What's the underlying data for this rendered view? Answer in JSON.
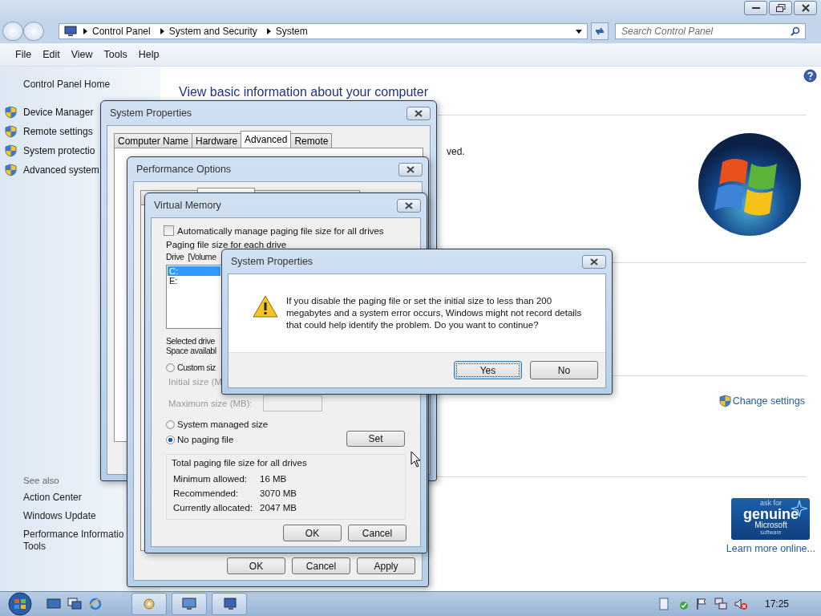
{
  "explorer": {
    "breadcrumbs": [
      "Control Panel",
      "System and Security",
      "System"
    ],
    "search_placeholder": "Search Control Panel",
    "menu": [
      "File",
      "Edit",
      "View",
      "Tools",
      "Help"
    ]
  },
  "sidebar": {
    "home": "Control Panel Home",
    "tasks": [
      "Device Manager",
      "Remote settings",
      "System protectio",
      "Advanced system"
    ],
    "see_also_title": "See also",
    "see_also": [
      {
        "lines": [
          "Action Center"
        ]
      },
      {
        "lines": [
          "Windows Update"
        ]
      },
      {
        "lines": [
          "Performance Informatio",
          "Tools"
        ]
      }
    ]
  },
  "main": {
    "heading": "View basic information about your computer",
    "fragment": "ved.",
    "change_settings": "Change settings",
    "genuine": [
      "ask for",
      "genuine",
      "Microsoft",
      "software"
    ],
    "learn_more": "Learn more online..."
  },
  "system_properties": {
    "title": "System Properties",
    "tabs": [
      {
        "label": "Computer Name",
        "selected": false
      },
      {
        "label": "Hardware",
        "selected": false
      },
      {
        "label": "Advanced",
        "selected": true
      },
      {
        "label": "Remote",
        "selected": false
      }
    ]
  },
  "performance_options": {
    "title": "Performance Options",
    "tabs": [
      {
        "selected": false
      },
      {
        "selected": true
      },
      {
        "selected": false
      }
    ],
    "buttons": [
      "OK",
      "Cancel",
      "Apply"
    ]
  },
  "virtual_memory": {
    "title": "Virtual Memory",
    "auto_manage": {
      "label": "Automatically manage paging file size for all drives",
      "checked": false
    },
    "paging_label": "Paging file size for each drive",
    "columns": [
      "Drive",
      "[Volume"
    ],
    "drives": [
      {
        "label": "C:",
        "selected": true
      },
      {
        "label": "E:",
        "selected": false
      }
    ],
    "selected_drive_label": "Selected drive",
    "space_label": "Space availabl",
    "custom": {
      "label": "Custom siz",
      "selected": false
    },
    "initial_label": "Initial size (M",
    "maximum_label": "Maximum size (MB):",
    "options": [
      {
        "label": "System managed size",
        "selected": false
      },
      {
        "label": "No paging file",
        "selected": true
      }
    ],
    "set_button": "Set",
    "totals": {
      "title": "Total paging file size for all drives",
      "rows": [
        {
          "label": "Minimum allowed:",
          "value": "16 MB"
        },
        {
          "label": "Recommended:",
          "value": "3070 MB"
        },
        {
          "label": "Currently allocated:",
          "value": "2047 MB"
        }
      ]
    },
    "buttons": [
      "OK",
      "Cancel"
    ]
  },
  "alert": {
    "title": "System Properties",
    "message": "If you disable the paging file or set the initial size to less than 200 megabytes and a system error occurs, Windows might not record details that could help identify the problem. Do you want to continue?",
    "buttons": [
      {
        "label": "Yes",
        "default": true
      },
      {
        "label": "No",
        "default": false
      }
    ]
  },
  "taskbar": {
    "clock": "17:25"
  }
}
